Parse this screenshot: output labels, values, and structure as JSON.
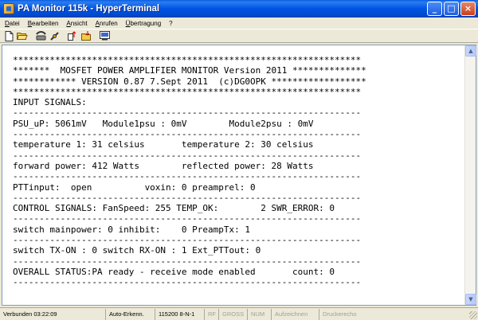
{
  "window": {
    "title": "PA Monitor 115k - HyperTerminal",
    "buttons": {
      "minimize": "_",
      "maximize": "□",
      "close": "×"
    }
  },
  "menu": [
    "Datei",
    "Bearbeiten",
    "Ansicht",
    "Anrufen",
    "Übertragung",
    "?"
  ],
  "toolbar": {
    "icons": [
      "new-icon",
      "open-icon",
      "phone-icon",
      "disconnect-icon",
      "send-icon",
      "receive-icon",
      "properties-icon"
    ]
  },
  "terminal": {
    "lines": [
      "******************************************************************",
      "*******  MOSFET POWER AMPLIFIER MONITOR Version 2011 **************",
      "************ VERSION 0.87 7.Sept 2011  (c)DG0OPK ******************",
      "******************************************************************",
      "INPUT SIGNALS:",
      "------------------------------------------------------------------",
      "PSU_uP: 5061mV   Module1psu : 0mV        Module2psu : 0mV",
      "------------------------------------------------------------------",
      "temperature 1: 31 celsius       temperature 2: 30 celsius",
      "------------------------------------------------------------------",
      "forward power: 412 Watts        reflected power: 28 Watts",
      "------------------------------------------------------------------",
      "PTTinput:  open          voxin: 0 preamprel: 0",
      "------------------------------------------------------------------",
      "CONTROL SIGNALS: FanSpeed: 255 TEMP_OK:        2 SWR_ERROR: 0",
      "------------------------------------------------------------------",
      "switch mainpower: 0 inhibit:    0 PreampTx: 1",
      "------------------------------------------------------------------",
      "switch TX-ON : 0 switch RX-ON : 1 Ext_PTTout: 0",
      "------------------------------------------------------------------",
      "OVERALL STATUS:PA ready - receive mode enabled       count: 0",
      "------------------------------------------------------------------"
    ]
  },
  "scrollbar": {
    "up": "▲",
    "down": "▼"
  },
  "statusbar": {
    "connected": "Verbunden 03:22:09",
    "detect": "Auto-Erkenn.",
    "baud": "115200 8-N-1",
    "rf": "RF",
    "caps": "GROSS",
    "num": "NUM",
    "capture": "Aufzeichnen",
    "echo": "Druckerecho"
  }
}
